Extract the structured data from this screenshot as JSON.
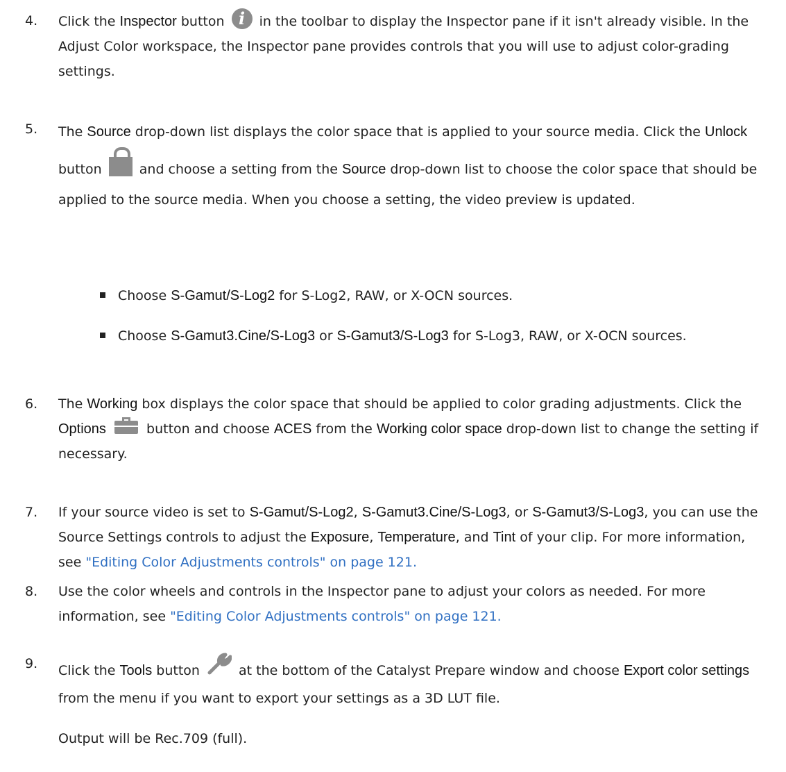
{
  "steps": [
    {
      "number": "4.",
      "p1": [
        "Click the ",
        {
          "ui": "Inspector"
        },
        " button ",
        {
          "icon": "info-icon"
        },
        " in the toolbar to display the Inspector pane if it isn't already visible. In the Adjust Color workspace, the Inspector pane provides controls that you will use to adjust color-grading settings."
      ]
    },
    {
      "number": "5.",
      "p1": [
        "The ",
        {
          "ui": "Source"
        },
        " drop-down list displays the color space that is applied to your source media. Click the ",
        {
          "ui": "Unlock"
        },
        " button ",
        {
          "icon": "lock-icon"
        },
        " and choose a setting from the ",
        {
          "ui": "Source"
        },
        " drop-down list to choose the color space that should be applied to the source media. When you choose a setting, the video preview is updated."
      ],
      "bullets": [
        [
          "Choose ",
          {
            "ui": "S-Gamut/S-Log2"
          },
          " for S-Log2, RAW, or X-OCN sources."
        ],
        [
          "Choose ",
          {
            "ui": "S-Gamut3.Cine/S-Log3"
          },
          " or ",
          {
            "ui": "S-Gamut3/S-Log3"
          },
          " for S-Log3, RAW, or X-OCN sources."
        ]
      ]
    },
    {
      "number": "6.",
      "p1": [
        "The ",
        {
          "ui": "Working"
        },
        "  box displays the color space that should be applied to color grading adjustments. Click the ",
        {
          "ui": "Options"
        },
        " ",
        {
          "icon": "briefcase-icon"
        },
        " button and choose ",
        {
          "ui": "ACES"
        },
        " from the ",
        {
          "ui": "Working color space"
        },
        " drop-down list to change the setting if necessary."
      ]
    },
    {
      "number": "7.",
      "p1": [
        "If your source video is set to ",
        {
          "ui": "S-Gamut/S-Log2"
        },
        ", ",
        {
          "ui": "S-Gamut3.Cine/S-Log3"
        },
        ", or ",
        {
          "ui": "S-Gamut3/S-Log3"
        },
        ", you can use the Source Settings controls to adjust the ",
        {
          "ui": "Exposure"
        },
        ", ",
        {
          "ui": "Temperature"
        },
        ", and ",
        {
          "ui": "Tint"
        },
        " of your clip. For more information, see ",
        {
          "link": "\"Editing Color Adjustments controls\" on page 121."
        }
      ]
    },
    {
      "number": "8.",
      "p1": [
        "Use the color wheels and controls in the Inspector pane to adjust your colors as needed. For more information, see ",
        {
          "link": "\"Editing Color Adjustments controls\" on page 121."
        }
      ]
    },
    {
      "number": "9.",
      "p1": [
        "Click the ",
        {
          "ui": "Tools"
        },
        " button ",
        {
          "icon": "wrench-icon"
        },
        " at the bottom of the Catalyst Prepare window and choose ",
        {
          "ui": "Export color settings"
        },
        " from the menu if you want to export your settings as a 3D LUT file."
      ],
      "p2": "Output will be Rec.709 (full)."
    }
  ],
  "colors": {
    "link": "#2f6fc2",
    "icon": "#8c8c8c",
    "text": "#222222"
  }
}
